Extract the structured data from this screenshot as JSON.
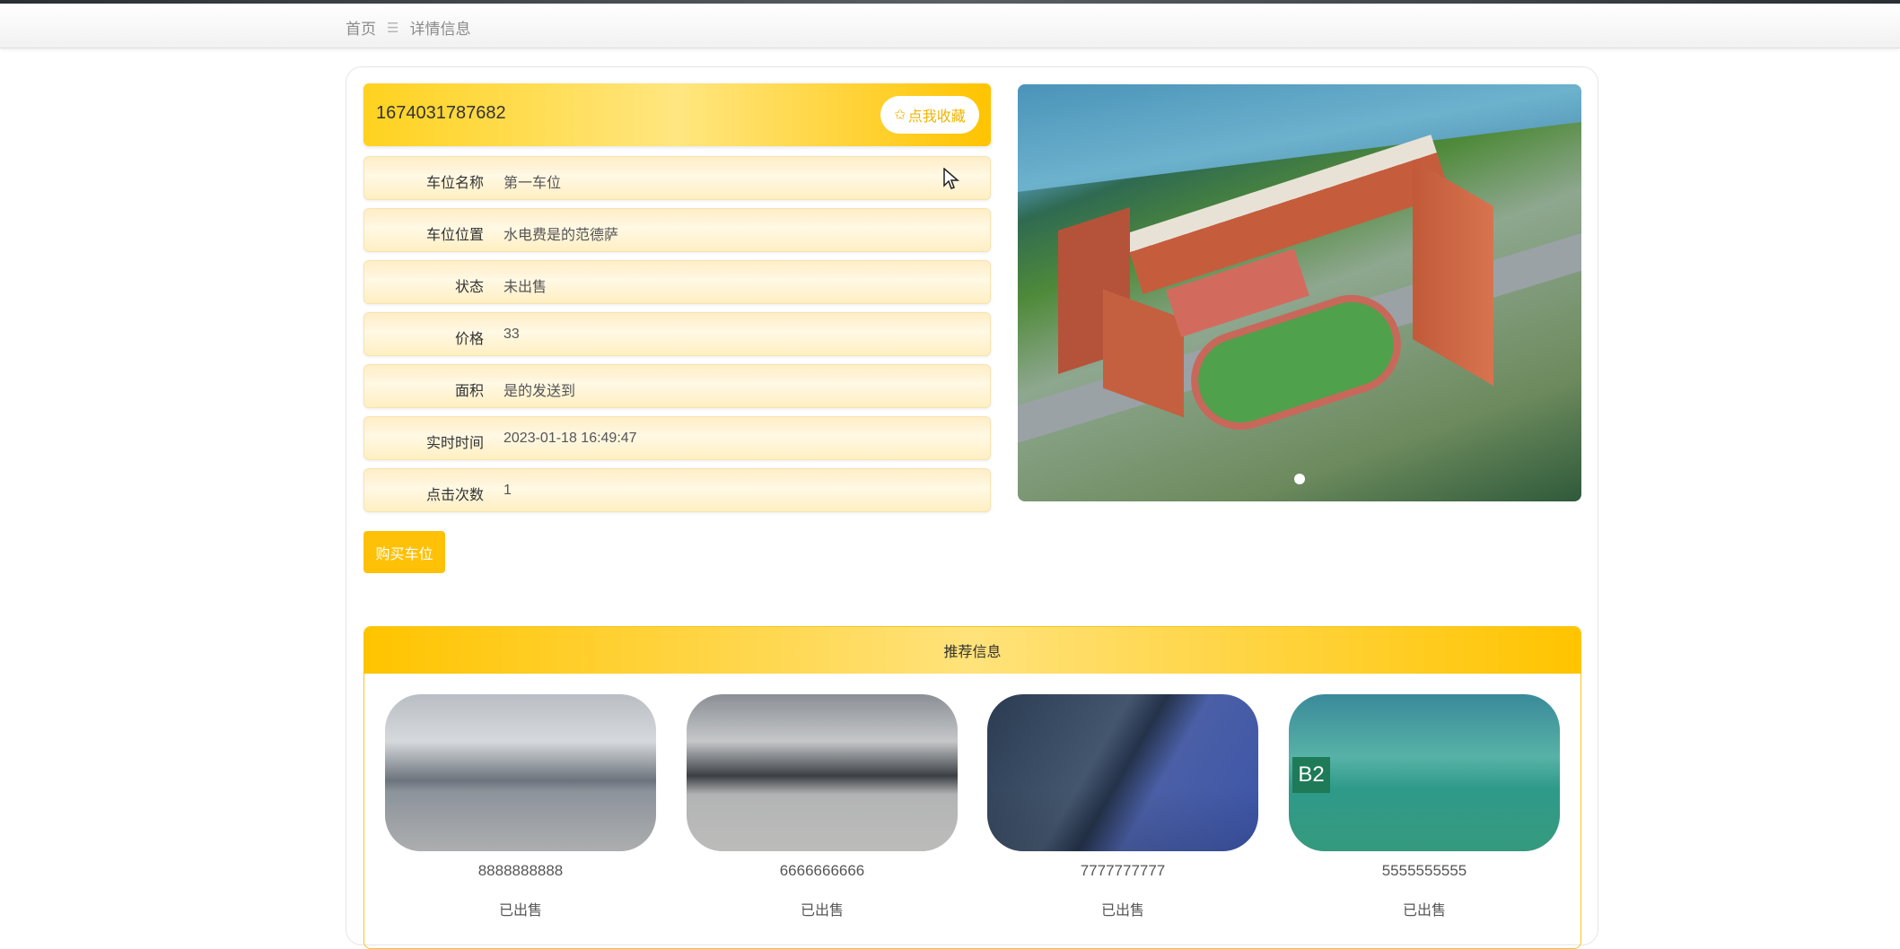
{
  "breadcrumb": {
    "home": "首页",
    "separator": "☰",
    "current": "详情信息"
  },
  "detail": {
    "title": "1674031787682",
    "collect_icon": "star-outline-icon",
    "collect_label": "点我收藏",
    "rows": [
      {
        "label": "车位名称",
        "value": "第一车位"
      },
      {
        "label": "车位位置",
        "value": "水电费是的范德萨"
      },
      {
        "label": "状态",
        "value": "未出售"
      },
      {
        "label": "价格",
        "value": "33"
      },
      {
        "label": "面积",
        "value": "是的发送到"
      },
      {
        "label": "实时时间",
        "value": "2023-01-18 16:49:47"
      },
      {
        "label": "点击次数",
        "value": "1"
      }
    ],
    "buy_label": "购买车位"
  },
  "recommend": {
    "title": "推荐信息",
    "items": [
      {
        "name": "8888888888",
        "status": "已出售"
      },
      {
        "name": "6666666666",
        "status": "已出售"
      },
      {
        "name": "7777777777",
        "status": "已出售"
      },
      {
        "name": "5555555555",
        "status": "已出售"
      }
    ],
    "image4_sign": "B2"
  },
  "colors": {
    "accent": "#ffc107",
    "accent_light": "#ffe680",
    "row_bg": "#fff8e4"
  }
}
